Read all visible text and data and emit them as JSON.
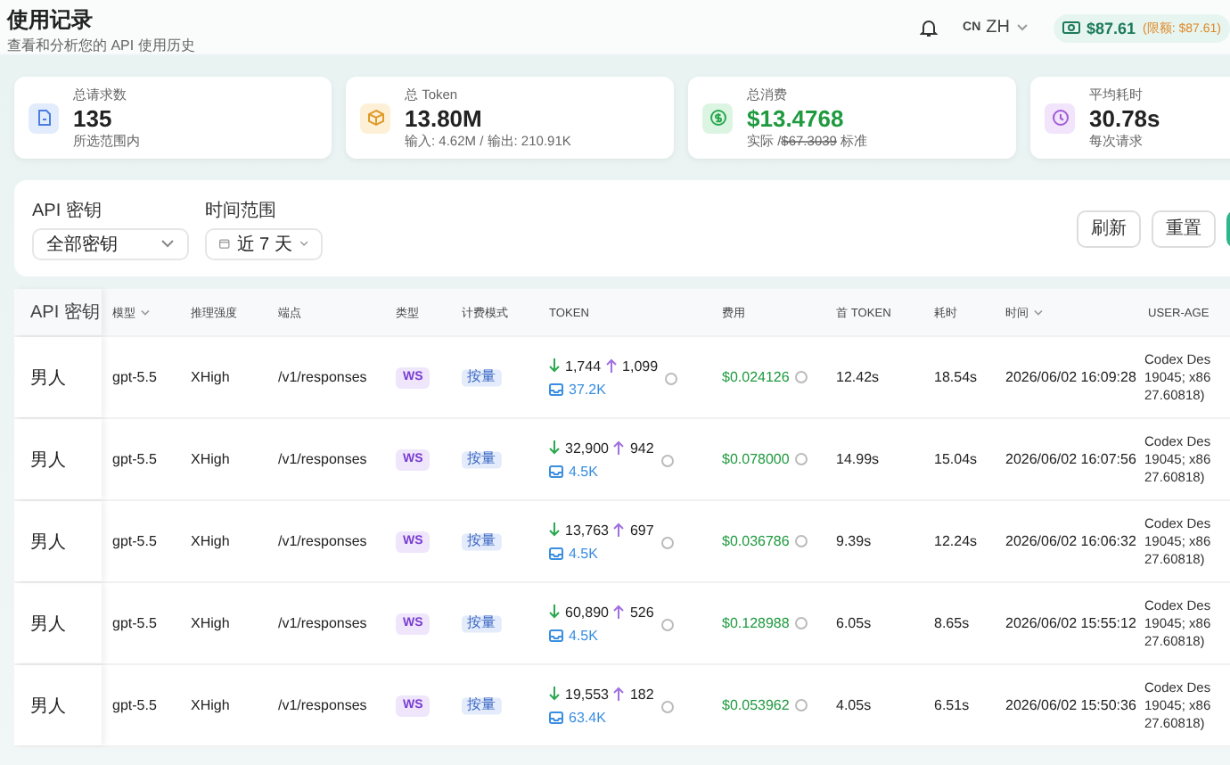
{
  "header": {
    "title": "使用记录",
    "subtitle": "查看和分析您的 API 使用历史",
    "lang_code": "CN",
    "lang": "ZH",
    "balance": "$87.61",
    "limit": "(限额: $87.61)"
  },
  "stats": [
    {
      "kind": "requests",
      "label": "总请求数",
      "value": "135",
      "note": "所选范围内"
    },
    {
      "kind": "tokens",
      "label": "总 Token",
      "value": "13.80M",
      "note": "输入: 4.62M / 输出: 210.91K"
    },
    {
      "kind": "cost",
      "label": "总消费",
      "value": "$13.4768",
      "note": "实际 /",
      "struck": "$67.3039",
      "note_end": "标准"
    },
    {
      "kind": "latency",
      "label": "平均耗时",
      "value": "30.78s",
      "note": "每次请求"
    }
  ],
  "filters": [
    {
      "kind": "select",
      "label": "API 密钥",
      "value": "全部密钥"
    },
    {
      "kind": "date",
      "label": "时间范围",
      "value": "近 7 天"
    }
  ],
  "buttons": [
    {
      "label": "刷新"
    },
    {
      "label": "重置"
    }
  ],
  "columns": [
    {
      "label": "API 密钥",
      "sortable": false
    },
    {
      "label": "模型",
      "sortable": true
    },
    {
      "label": "推理强度",
      "sortable": false
    },
    {
      "label": "端点",
      "sortable": false
    },
    {
      "label": "类型",
      "sortable": false
    },
    {
      "label": "计费模式",
      "sortable": false
    },
    {
      "label": "TOKEN",
      "sortable": false
    },
    {
      "label": "费用",
      "sortable": false
    },
    {
      "label": "首 TOKEN",
      "sortable": false
    },
    {
      "label": "耗时",
      "sortable": false
    },
    {
      "label": "时间",
      "sortable": true
    },
    {
      "label": "USER-AGE",
      "sortable": false
    }
  ],
  "rows": [
    {
      "key": "男人",
      "model": "gpt-5.5",
      "effort": "XHigh",
      "endpoint": "/v1/responses",
      "type": "WS",
      "billing": "按量",
      "tokens_in": "1,744",
      "tokens_out": "1,099",
      "cache": "37.2K",
      "cost": "$0.024126",
      "first_token": "12.42s",
      "duration": "18.54s",
      "time": "2026/06/02 16:09:28",
      "user_agent": [
        "Codex Des",
        "19045; x86",
        "27.60818)"
      ]
    },
    {
      "key": "男人",
      "model": "gpt-5.5",
      "effort": "XHigh",
      "endpoint": "/v1/responses",
      "type": "WS",
      "billing": "按量",
      "tokens_in": "32,900",
      "tokens_out": "942",
      "cache": "4.5K",
      "cost": "$0.078000",
      "first_token": "14.99s",
      "duration": "15.04s",
      "time": "2026/06/02 16:07:56",
      "user_agent": [
        "Codex Des",
        "19045; x86",
        "27.60818)"
      ]
    },
    {
      "key": "男人",
      "model": "gpt-5.5",
      "effort": "XHigh",
      "endpoint": "/v1/responses",
      "type": "WS",
      "billing": "按量",
      "tokens_in": "13,763",
      "tokens_out": "697",
      "cache": "4.5K",
      "cost": "$0.036786",
      "first_token": "9.39s",
      "duration": "12.24s",
      "time": "2026/06/02 16:06:32",
      "user_agent": [
        "Codex Des",
        "19045; x86",
        "27.60818)"
      ]
    },
    {
      "key": "男人",
      "model": "gpt-5.5",
      "effort": "XHigh",
      "endpoint": "/v1/responses",
      "type": "WS",
      "billing": "按量",
      "tokens_in": "60,890",
      "tokens_out": "526",
      "cache": "4.5K",
      "cost": "$0.128988",
      "first_token": "6.05s",
      "duration": "8.65s",
      "time": "2026/06/02 15:55:12",
      "user_agent": [
        "Codex Des",
        "19045; x86",
        "27.60818)"
      ]
    },
    {
      "key": "男人",
      "model": "gpt-5.5",
      "effort": "XHigh",
      "endpoint": "/v1/responses",
      "type": "WS",
      "billing": "按量",
      "tokens_in": "19,553",
      "tokens_out": "182",
      "cache": "63.4K",
      "cost": "$0.053962",
      "first_token": "4.05s",
      "duration": "6.51s",
      "time": "2026/06/02 15:50:36",
      "user_agent": [
        "Codex Des",
        "19045; x86",
        "27.60818)"
      ]
    }
  ]
}
